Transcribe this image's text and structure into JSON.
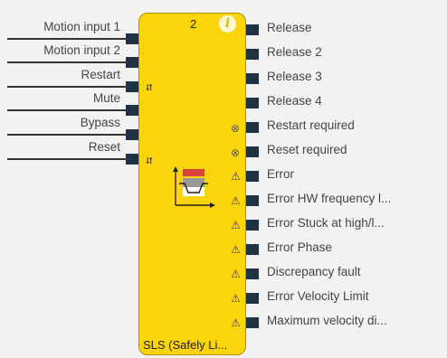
{
  "block": {
    "number": "2",
    "info": "i",
    "title": "SLS (Safely Li..."
  },
  "inputs": [
    {
      "label": "Motion input 1",
      "edge": ""
    },
    {
      "label": "Motion input 2",
      "edge": ""
    },
    {
      "label": "Restart",
      "edge": "⮃"
    },
    {
      "label": "Mute",
      "edge": ""
    },
    {
      "label": "Bypass",
      "edge": ""
    },
    {
      "label": "Reset",
      "edge": "⮃"
    }
  ],
  "outputs": [
    {
      "label": "Release",
      "icon": ""
    },
    {
      "label": "Release 2",
      "icon": ""
    },
    {
      "label": "Release 3",
      "icon": ""
    },
    {
      "label": "Release 4",
      "icon": ""
    },
    {
      "label": "Restart required",
      "icon": "⊗"
    },
    {
      "label": "Reset required",
      "icon": "⊗"
    },
    {
      "label": "Error",
      "icon": "⚠"
    },
    {
      "label": "Error HW frequency l...",
      "icon": "⚠"
    },
    {
      "label": "Error Stuck at high/l...",
      "icon": "⚠"
    },
    {
      "label": "Error Phase",
      "icon": "⚠"
    },
    {
      "label": "Discrepancy fault",
      "icon": "⚠"
    },
    {
      "label": "Error Velocity Limit",
      "icon": "⚠"
    },
    {
      "label": "Maximum velocity di...",
      "icon": "⚠"
    }
  ],
  "colors": {
    "block_fill": "#fcd40c",
    "pin": "#1f3345",
    "graph_red": "#d9413a",
    "graph_gray": "#9a9a9a"
  },
  "icons": {
    "edge": "rising-edge-icon",
    "status": "cancel-circle-icon",
    "warning": "warning-triangle-icon",
    "function": "speed-limit-graph-icon"
  }
}
